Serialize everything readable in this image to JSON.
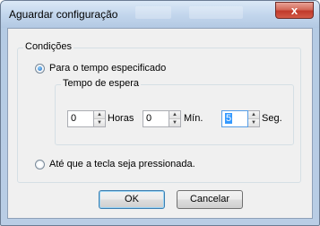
{
  "window": {
    "title": "Aguardar configuração",
    "close_glyph": "x"
  },
  "conditions": {
    "legend": "Condições",
    "option_time": "Para o tempo especificado",
    "option_key": "Até que a tecla seja pressionada.",
    "selected": "option_time"
  },
  "wait_time": {
    "legend": "Tempo de espera",
    "hours": {
      "value": "0",
      "unit": "Horas"
    },
    "minutes": {
      "value": "0",
      "unit": "Mín."
    },
    "seconds": {
      "value": "5",
      "unit": "Seg."
    }
  },
  "buttons": {
    "ok": "OK",
    "cancel": "Cancelar"
  },
  "icons": [
    "close-icon",
    "spin-up-arrow",
    "spin-down-arrow",
    "radio-button"
  ]
}
